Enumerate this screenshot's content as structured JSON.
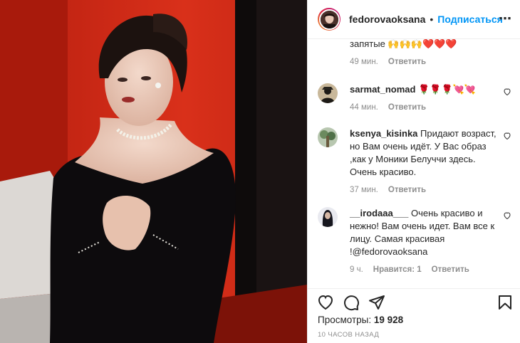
{
  "header": {
    "username": "fedorovaoksana",
    "separator": "•",
    "follow_label": "Подписаться",
    "more_icon": "⋯"
  },
  "comments": [
    {
      "text": "запятые 🙌🙌🙌❤️❤️❤️",
      "time": "49 мин.",
      "reply": "Ответить"
    },
    {
      "username": "sarmat_nomad",
      "text": "🌹🌹🌹💘💘",
      "time": "44 мин.",
      "reply": "Ответить"
    },
    {
      "username": "ksenya_kisinka",
      "text": "Придают возраст, но Вам очень идёт. У Вас образ ,как у Моники Белуччи здесь. Очень красиво.",
      "time": "37 мин.",
      "reply": "Ответить"
    },
    {
      "username": "__irodaaa___",
      "text": "Очень красиво и нежно! Вам очень идет. Вам все к лицу. Самая красивая !@fedorovaoksana",
      "time": "9 ч.",
      "likes": "Нравится: 1",
      "reply": "Ответить"
    }
  ],
  "footer": {
    "views_label": "Просмотры:",
    "views_count": "19 928",
    "timestamp": "10 ЧАСОВ НАЗАД"
  },
  "colors": {
    "accent": "#0095f6",
    "muted": "#8e8e8e",
    "background_red": "#d22a14"
  }
}
